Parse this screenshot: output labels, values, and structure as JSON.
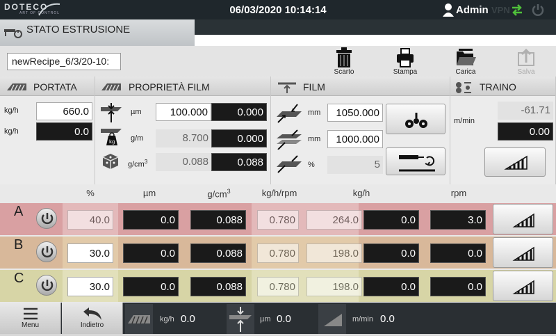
{
  "topbar": {
    "logo_text": "DOTECO",
    "logo_tagline": "ART OF CONTROL",
    "datetime": "06/03/2020 10:14:14",
    "user": "Admin",
    "vpn": "VPN"
  },
  "title": "STATO ESTRUSIONE",
  "recipe": {
    "name": "newRecipe_6/3/20-10:"
  },
  "toolbar": {
    "scarto": "Scarto",
    "stampa": "Stampa",
    "carica": "Carica",
    "salva": "Salva"
  },
  "portata": {
    "title": "PORTATA",
    "unit1": "kg/h",
    "value1": "660.0",
    "unit2": "kg/h",
    "value2": "0.0"
  },
  "proprieta": {
    "title": "PROPRIETÀ FILM",
    "rows": [
      {
        "unit": "µm",
        "set": "100.000",
        "act": "0.000"
      },
      {
        "unit": "g/m",
        "set": "8.700",
        "act": "0.000"
      },
      {
        "unit": "g/cm",
        "unit_sup": "3",
        "set": "0.088",
        "act": "0.088"
      }
    ]
  },
  "film": {
    "title": "FILM",
    "rows": [
      {
        "unit": "mm",
        "value": "1050.000"
      },
      {
        "unit": "mm",
        "value": "1000.000"
      },
      {
        "unit": "%",
        "value": "5"
      }
    ]
  },
  "traino": {
    "title": "TRAINO",
    "unit": "m/min",
    "set": "-61.71",
    "act": "0.00"
  },
  "table": {
    "headers": [
      "%",
      "µm",
      "g/cm",
      "kg/h/rpm",
      "kg/h",
      "rpm"
    ],
    "header_sup": "3",
    "rows": [
      {
        "label": "A",
        "pct": "40.0",
        "um": "0.0",
        "dens": "0.088",
        "ratio": "0.780",
        "kgh_set": "264.0",
        "kgh_act": "0.0",
        "rpm": "3.0"
      },
      {
        "label": "B",
        "pct": "30.0",
        "um": "0.0",
        "dens": "0.088",
        "ratio": "0.780",
        "kgh_set": "198.0",
        "kgh_act": "0.0",
        "rpm": "0.0"
      },
      {
        "label": "C",
        "pct": "30.0",
        "um": "0.0",
        "dens": "0.088",
        "ratio": "0.780",
        "kgh_set": "198.0",
        "kgh_act": "0.0",
        "rpm": "0.0"
      }
    ]
  },
  "bottom": {
    "menu": "Menu",
    "back": "Indietro",
    "kgh_unit": "kg/h",
    "kgh_value": "0.0",
    "um_unit": "µm",
    "um_value": "0.0",
    "speed_unit": "m/min",
    "speed_value": "0.0"
  },
  "colors": {
    "row_a": "#d9a0a2",
    "row_b": "#d8b89a",
    "row_c": "#d7d5a6",
    "topbar": "#1f272c",
    "accent_green": "#4fc13a"
  }
}
